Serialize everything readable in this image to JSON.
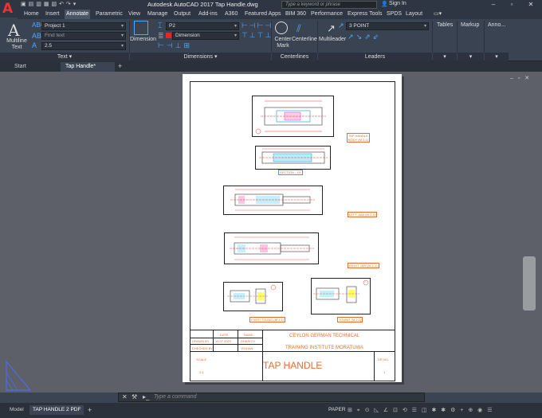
{
  "window": {
    "title": "Autodesk AutoCAD 2017    Tap Handle.dwg",
    "search_placeholder": "Type a keyword or phrase",
    "signin": "Sign In"
  },
  "ribbon_tabs": [
    "Home",
    "Insert",
    "Annotate",
    "Parametric",
    "View",
    "Manage",
    "Output",
    "Add-ins",
    "A360",
    "Featured Apps",
    "BIM 360",
    "Performance",
    "Express Tools",
    "SPDS",
    "Layout"
  ],
  "active_tab": "Annotate",
  "ribbon": {
    "text_panel": {
      "multiline_text": "Multiline Text",
      "text_style": "Project 1",
      "find_text": "Find text",
      "text_height": "2.5",
      "title": "Text"
    },
    "dimensions_panel": {
      "dimension_big": "Dimension",
      "dim_style": "P2",
      "dim_layer": "Dimension",
      "title": "Dimensions"
    },
    "centerlines_panel": {
      "center_mark": "Center Mark",
      "centerline": "Centerline",
      "title": "Centerlines"
    },
    "leaders_panel": {
      "multileader": "Multileader",
      "leader_style": "3 POINT",
      "title": "Leaders"
    },
    "tables_panel": {
      "title": "Tables"
    },
    "markup_panel": {
      "title": "Markup"
    },
    "anno_panel": {
      "title": "Anno..."
    }
  },
  "doc_tabs": [
    "Start",
    "Tap Handle*"
  ],
  "drawing": {
    "labels": {
      "tap_handle_body": "TAP HANDLE\nBODY (M 2:1)",
      "section": "SECTION - XX",
      "left_jaw": "LEFT JAW (M 2:1)",
      "right_jaw": "RIGHT JAW (M 2:1)",
      "fixed_tong": "FIXED TOUNG (M 2:1)",
      "tong_m": "TOUNG (M 2:1)"
    },
    "title_block": {
      "date_hdr": "DATE",
      "name_hdr": "NAME",
      "drawn_by": "DRAWN BY",
      "drawn_date": "15.07.2023",
      "drawn_name": "DHARITH",
      "checked_by": "CHECKED BY",
      "checked_name": "ROHAN",
      "institute_line1": "CEYLON GERMAN TECHNICAL",
      "institute_line2": "TRAINING INSTITUTE MORATUWA",
      "scale_hdr": "SCALE",
      "scale": "2:1",
      "title": "TAP HANDLE",
      "drg_no_hdr": "DR NO.",
      "drg_no": "1"
    }
  },
  "command": {
    "placeholder": "Type a command"
  },
  "status": {
    "layout_tabs": [
      "Model",
      "TAP HANDLE 2 PDF"
    ],
    "paper": "PAPER"
  }
}
